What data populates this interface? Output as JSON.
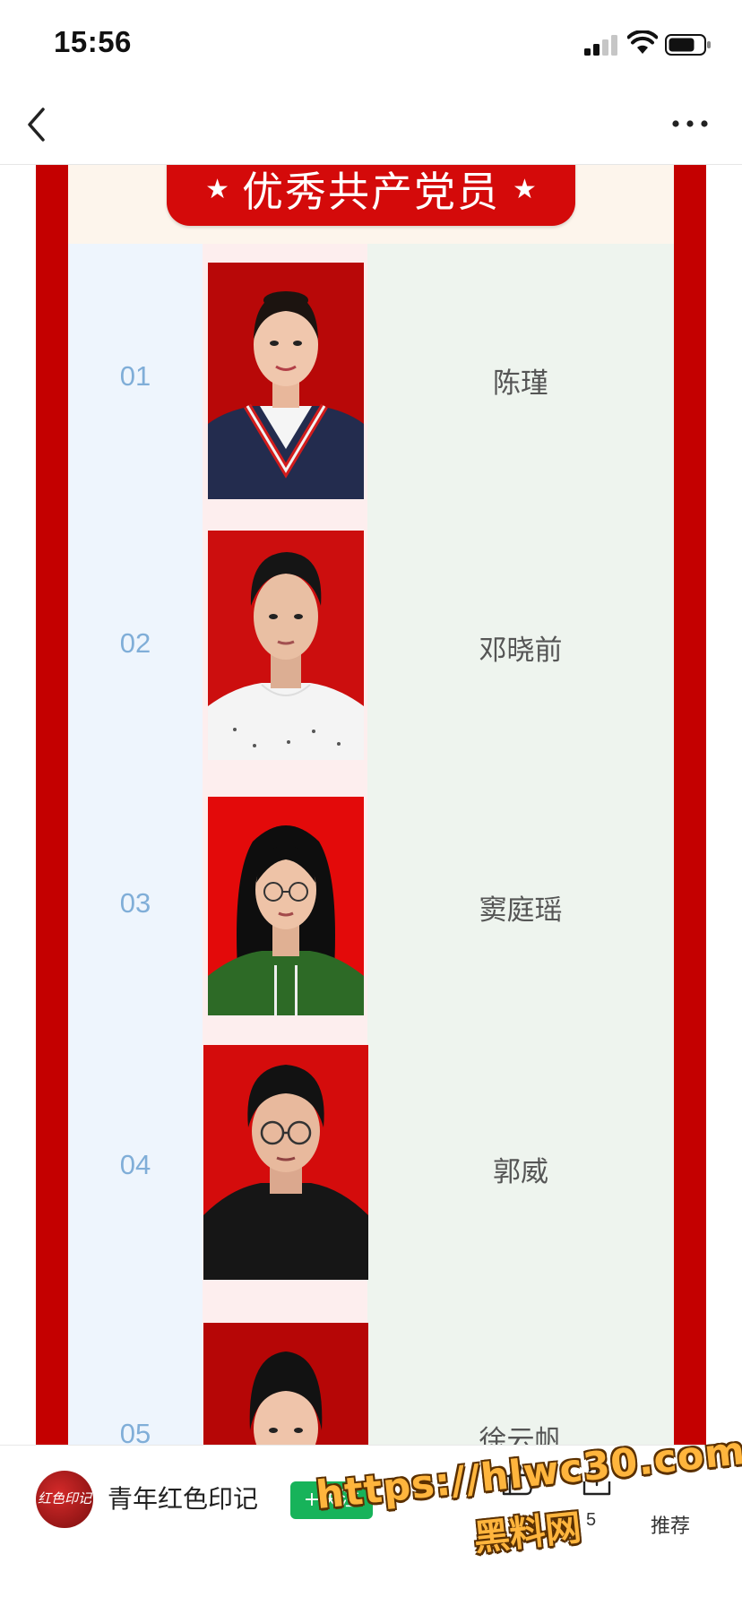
{
  "status_bar": {
    "time": "15:56",
    "icons": [
      "cellular-signal-icon",
      "wifi-icon",
      "battery-icon"
    ]
  },
  "nav": {
    "back_icon": "chevron-left-icon",
    "more_icon": "more-horizontal-icon"
  },
  "article": {
    "banner_title": "优秀共产党员",
    "banner_star": "★",
    "members": [
      {
        "number": "01",
        "name": "陈瑾"
      },
      {
        "number": "02",
        "name": "邓晓前"
      },
      {
        "number": "03",
        "name": "窦庭瑶"
      },
      {
        "number": "04",
        "name": "郭威"
      },
      {
        "number": "05",
        "name": "徐云帆"
      }
    ]
  },
  "bottom_bar": {
    "account_name": "青年红色印记",
    "avatar_text": "红色印记",
    "follow_label": "+关注",
    "like_count": "5",
    "recommend_label": "推荐"
  },
  "watermark": {
    "url": "https://hlwc30.com",
    "site_name": "黑料网"
  },
  "colors": {
    "frame_red": "#c40000",
    "banner_red": "#d40a0a",
    "number_blue": "#80aed8",
    "follow_green": "#17b35a",
    "watermark_orange": "#ffb53d"
  }
}
